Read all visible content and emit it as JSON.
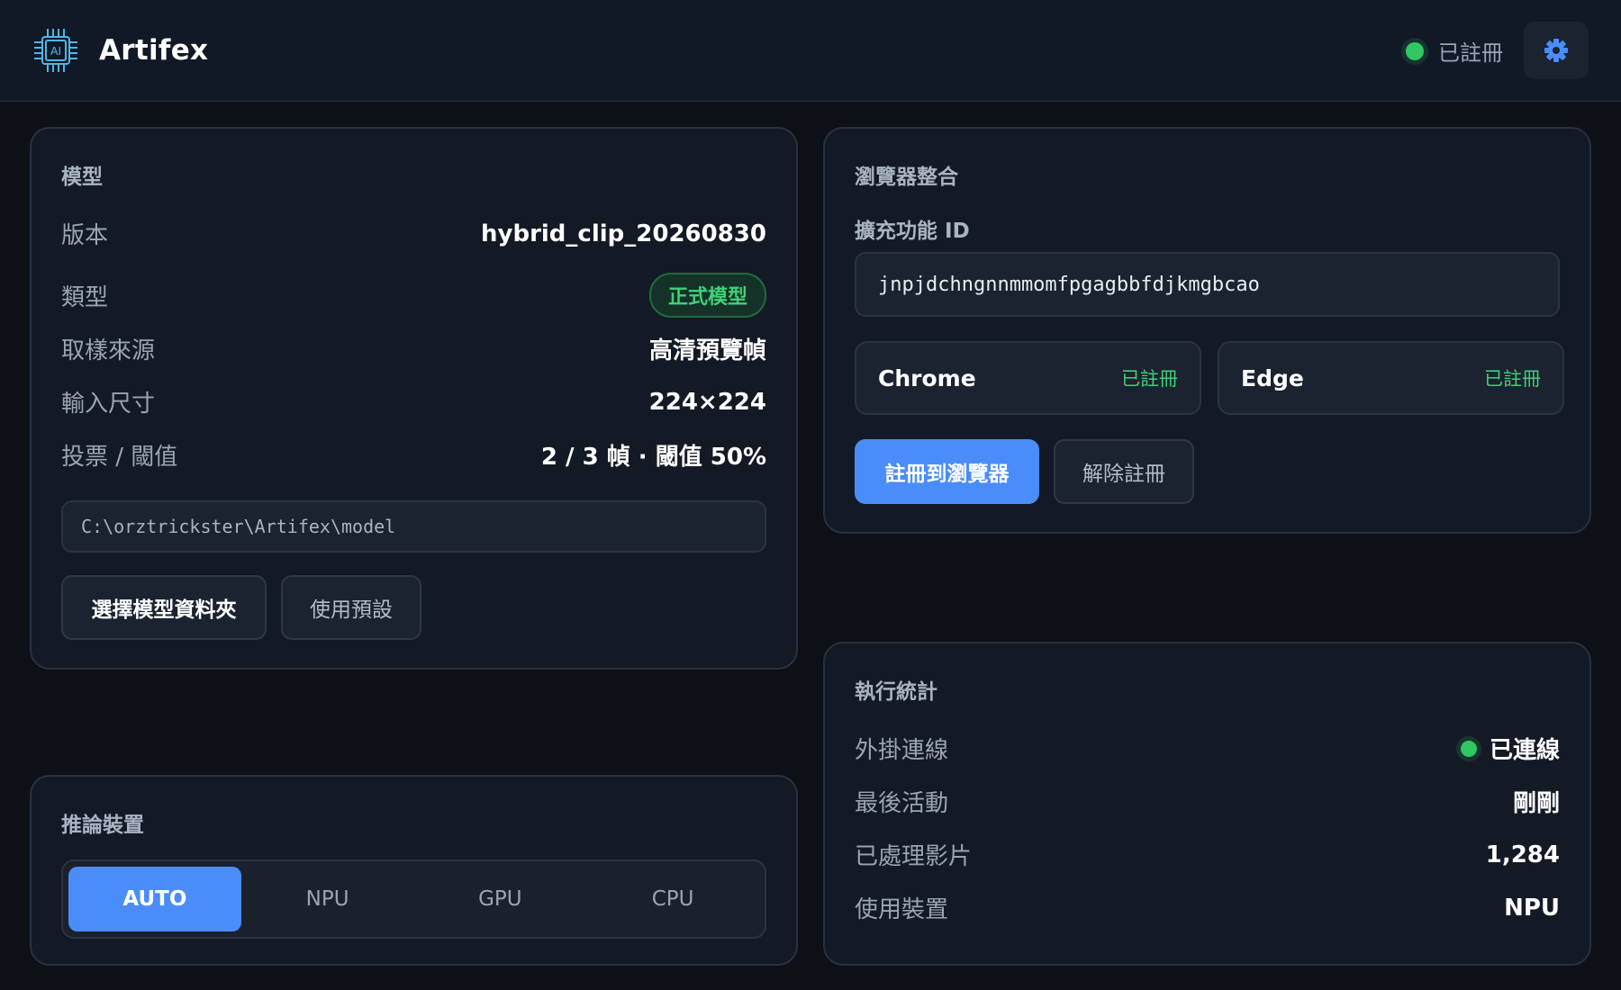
{
  "app": {
    "name": "Artifex",
    "status": "已註冊",
    "logo_text": "AI"
  },
  "colors": {
    "accent": "#4a8dfa",
    "success": "#2fc862",
    "background": "#0d1117",
    "card": "#141a25"
  },
  "icons": {
    "logo": "ai-chip-icon",
    "settings": "gear-icon",
    "status": "status-dot"
  },
  "model": {
    "title": "模型",
    "rows": [
      {
        "label": "版本",
        "value": "hybrid_clip_20260830"
      },
      {
        "label": "類型",
        "value": "正式模型"
      },
      {
        "label": "取樣來源",
        "value": "高清預覽幀"
      },
      {
        "label": "輸入尺寸",
        "value": "224×224"
      },
      {
        "label": "投票 / 閾值",
        "value": "2 / 3 幀 · 閾值 50%"
      }
    ],
    "path": "C:\\orztrickster\\Artifex\\model",
    "select_button": "選擇模型資料夾",
    "default_button": "使用預設"
  },
  "device": {
    "title": "推論裝置",
    "options": [
      "AUTO",
      "NPU",
      "GPU",
      "CPU"
    ],
    "selected": "AUTO"
  },
  "browser": {
    "title": "瀏覽器整合",
    "extension_label": "擴充功能 ID",
    "extension_id": "jnpjdchngnnmmomfpgagbbfdjkmgbcao",
    "browsers": [
      {
        "name": "Chrome",
        "status": "已註冊"
      },
      {
        "name": "Edge",
        "status": "已註冊"
      }
    ],
    "register_button": "註冊到瀏覽器",
    "unregister_button": "解除註冊"
  },
  "stats": {
    "title": "執行統計",
    "rows": [
      {
        "label": "外掛連線",
        "value": "已連線"
      },
      {
        "label": "最後活動",
        "value": "剛剛"
      },
      {
        "label": "已處理影片",
        "value": "1,284"
      },
      {
        "label": "使用裝置",
        "value": "NPU"
      }
    ]
  }
}
